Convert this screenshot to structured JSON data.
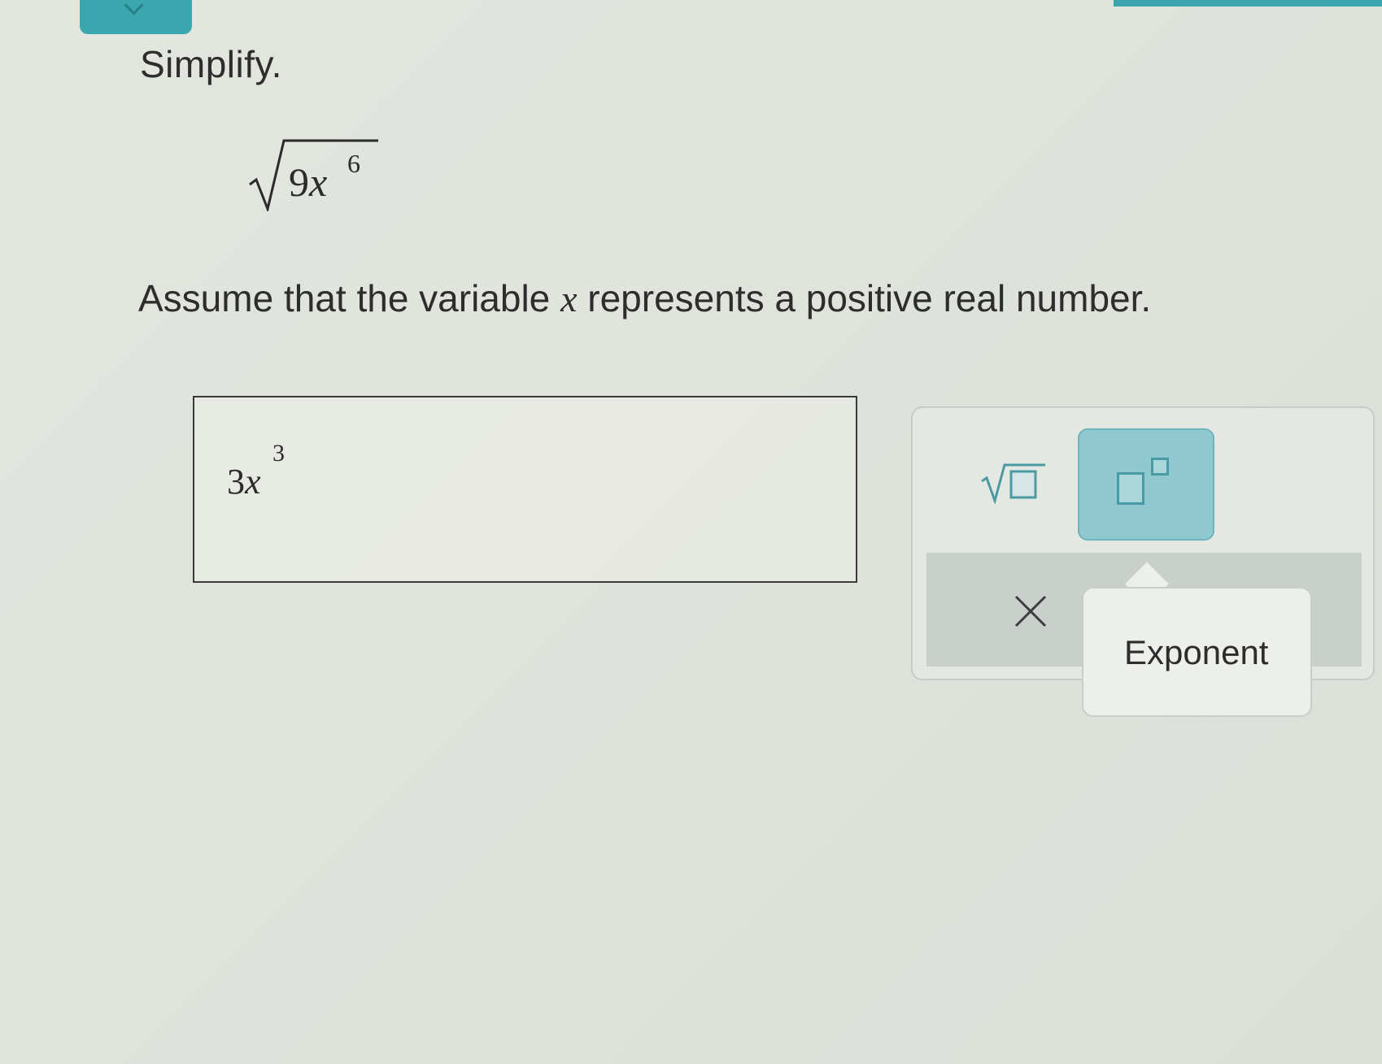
{
  "header": {
    "accent_color": "#3aa6ad",
    "collapse_icon": "chevron-down-icon"
  },
  "question": {
    "instruction": "Simplify.",
    "radicand_coefficient": "9",
    "radicand_variable": "x",
    "radicand_exponent": "6",
    "assumption_before": "Assume that the variable ",
    "assumption_variable": "x",
    "assumption_after": " represents a positive real number."
  },
  "answer": {
    "coefficient": "3",
    "variable": "x",
    "exponent": "3"
  },
  "toolbar": {
    "sqrt_icon": "square-root-template-icon",
    "exponent_icon": "exponent-template-icon",
    "clear_icon": "close-icon",
    "active_button_color": "#8fc8cf",
    "tooltip": "Exponent"
  }
}
